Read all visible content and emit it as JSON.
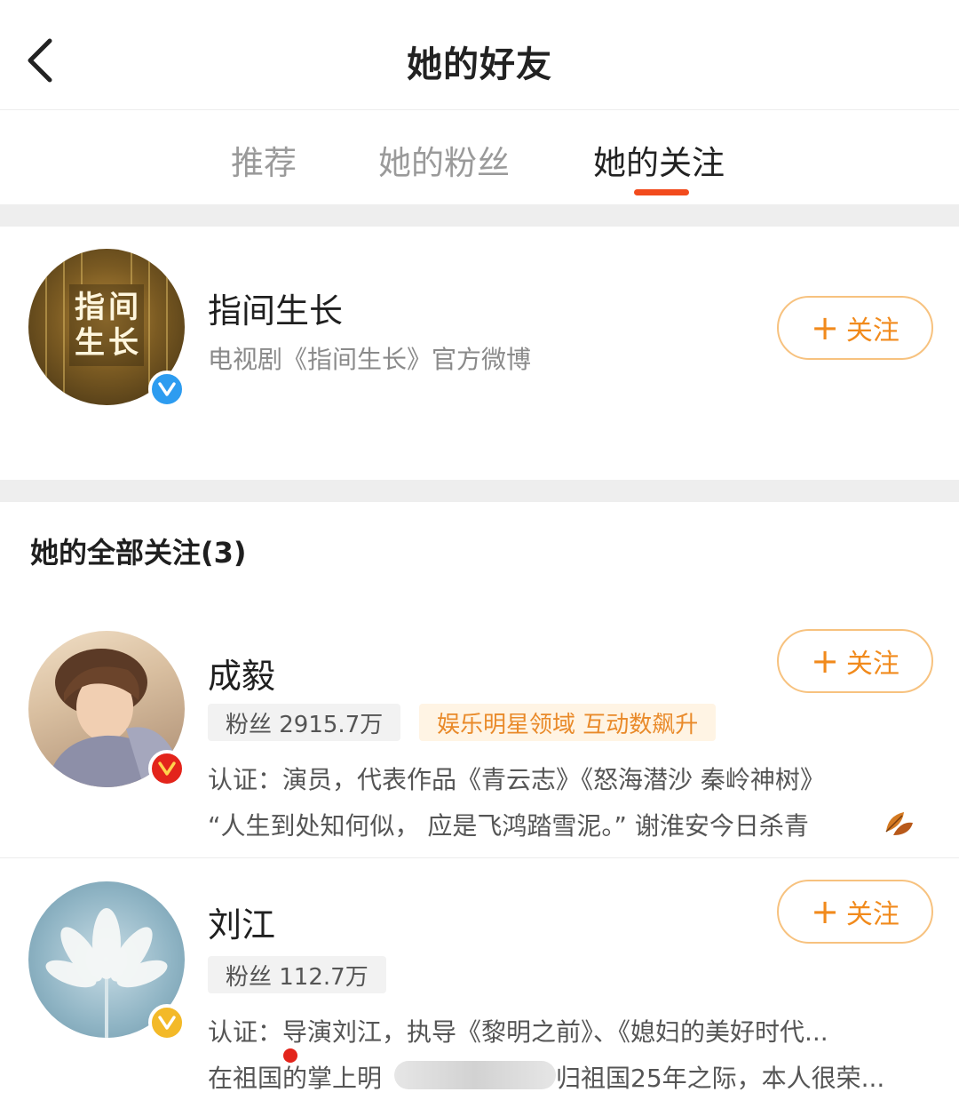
{
  "header": {
    "title": "她的好友"
  },
  "tabs": [
    {
      "label": "推荐",
      "active": false
    },
    {
      "label": "她的粉丝",
      "active": false
    },
    {
      "label": "她的关注",
      "active": true
    }
  ],
  "recommended": {
    "name": "指间生长",
    "description": "电视剧《指间生长》官方微博",
    "avatar_text": "指间生长",
    "badge": "blue-v-badge",
    "follow_label": "关注"
  },
  "section": {
    "title": "她的全部关注(3)"
  },
  "users": [
    {
      "name": "成毅",
      "fans": "粉丝 2915.7万",
      "tag": "娱乐明星领域 互动数飙升",
      "line1": "认证：演员，代表作品《青云志》《怒海潜沙 秦岭神树》",
      "line2": "“人生到处知何似， 应是飞鸿踏雪泥。” 谢淮安今日杀青",
      "badge": "red-v-badge",
      "follow_label": "关注"
    },
    {
      "name": "刘江",
      "fans": "粉丝 112.7万",
      "line1": "认证：导演刘江，执导《黎明之前》、《媳妇的美好时代...",
      "line2a": "在祖国的掌上明",
      "line2b": "归祖国25年之际，本人很荣...",
      "badge": "yellow-v-badge",
      "follow_label": "关注"
    }
  ],
  "colors": {
    "accent": "#f24b1d",
    "follow": "#f18a1c",
    "blue_badge": "#2d9cf0",
    "red_badge": "#e3241b",
    "yellow_badge": "#f3b928"
  }
}
